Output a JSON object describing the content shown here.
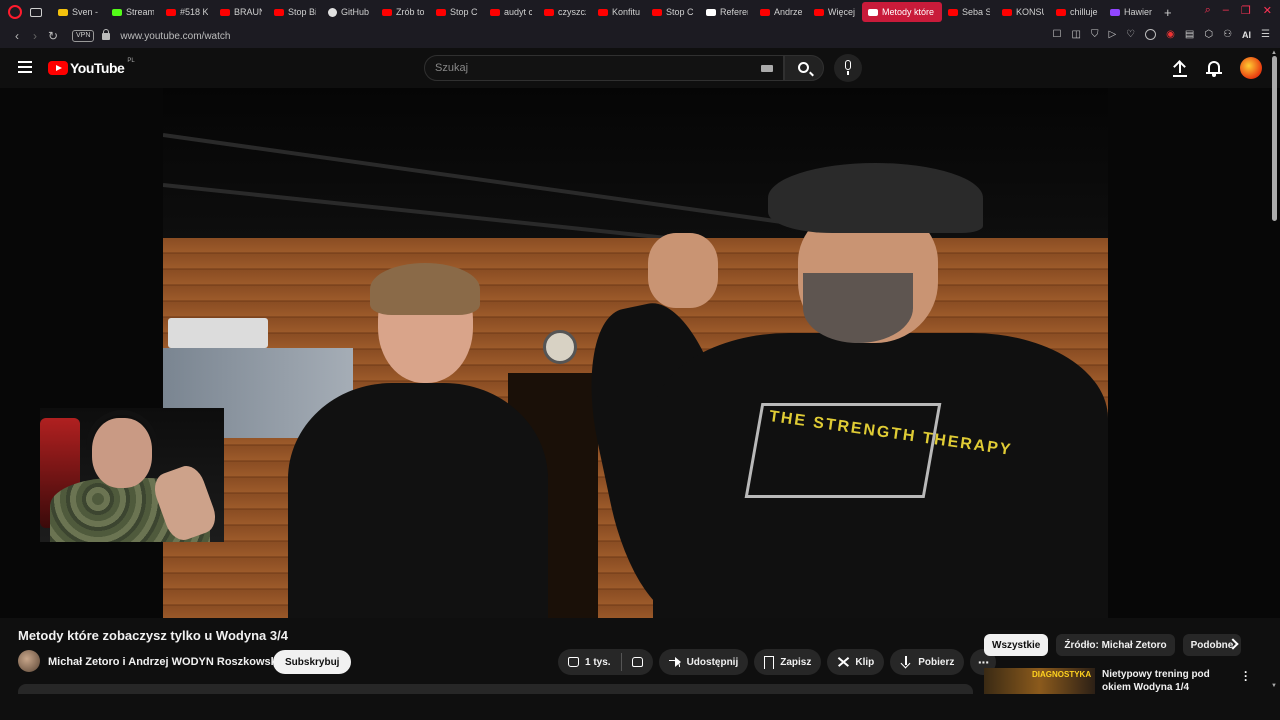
{
  "browser": {
    "tabs": [
      {
        "label": "Sven -",
        "icon": "crown"
      },
      {
        "label": "Stream",
        "icon": "kick"
      },
      {
        "label": "#518 K",
        "icon": "youtube"
      },
      {
        "label": "BRAUN",
        "icon": "youtube"
      },
      {
        "label": "Stop Bi",
        "icon": "youtube"
      },
      {
        "label": "GitHub",
        "icon": "github"
      },
      {
        "label": "Zrób to",
        "icon": "youtube"
      },
      {
        "label": "Stop Cl",
        "icon": "youtube"
      },
      {
        "label": "audyt c",
        "icon": "youtube"
      },
      {
        "label": "czyszcz",
        "icon": "youtube"
      },
      {
        "label": "Konfitu",
        "icon": "youtube"
      },
      {
        "label": "Stop Cl",
        "icon": "youtube"
      },
      {
        "label": "Referen",
        "icon": "ref"
      },
      {
        "label": "Andrze",
        "icon": "youtube"
      },
      {
        "label": "Więcej",
        "icon": "youtube"
      },
      {
        "label": "Metody które",
        "icon": "youtube",
        "active": true
      },
      {
        "label": "Seba S",
        "icon": "youtube"
      },
      {
        "label": "KONSU",
        "icon": "youtube"
      },
      {
        "label": "chilluje",
        "icon": "youtube"
      },
      {
        "label": "Hawier",
        "icon": "twitch"
      }
    ],
    "new_tab": "+",
    "url": "www.youtube.com/watch",
    "vpn_label": "VPN",
    "ai_label": "AI",
    "accent": "#c91b3a"
  },
  "youtube": {
    "brand": "YouTube",
    "region": "PL",
    "search_placeholder": "Szukaj",
    "video": {
      "title": "Metody które zobaczysz tylko u Wodyna 3/4",
      "channel": "Michał Zetoro i Andrzej WODYN Roszkowski",
      "subscribe_label": "Subskrybuj",
      "likes": "1 tys.",
      "share_label": "Udostępnij",
      "save_label": "Zapisz",
      "clip_label": "Klip",
      "download_label": "Pobierz",
      "shirt_text": "THE STRENGTH THERAPY"
    },
    "chips": [
      {
        "label": "Wszystkie",
        "active": true
      },
      {
        "label": "Źródło: Michał Zetoro",
        "active": false
      },
      {
        "label": "Podobne",
        "active": false
      }
    ],
    "recommendation": {
      "badge": "DIAGNOSTYKA",
      "title": "Nietypowy trening pod okiem Wodyna 1/4"
    }
  }
}
